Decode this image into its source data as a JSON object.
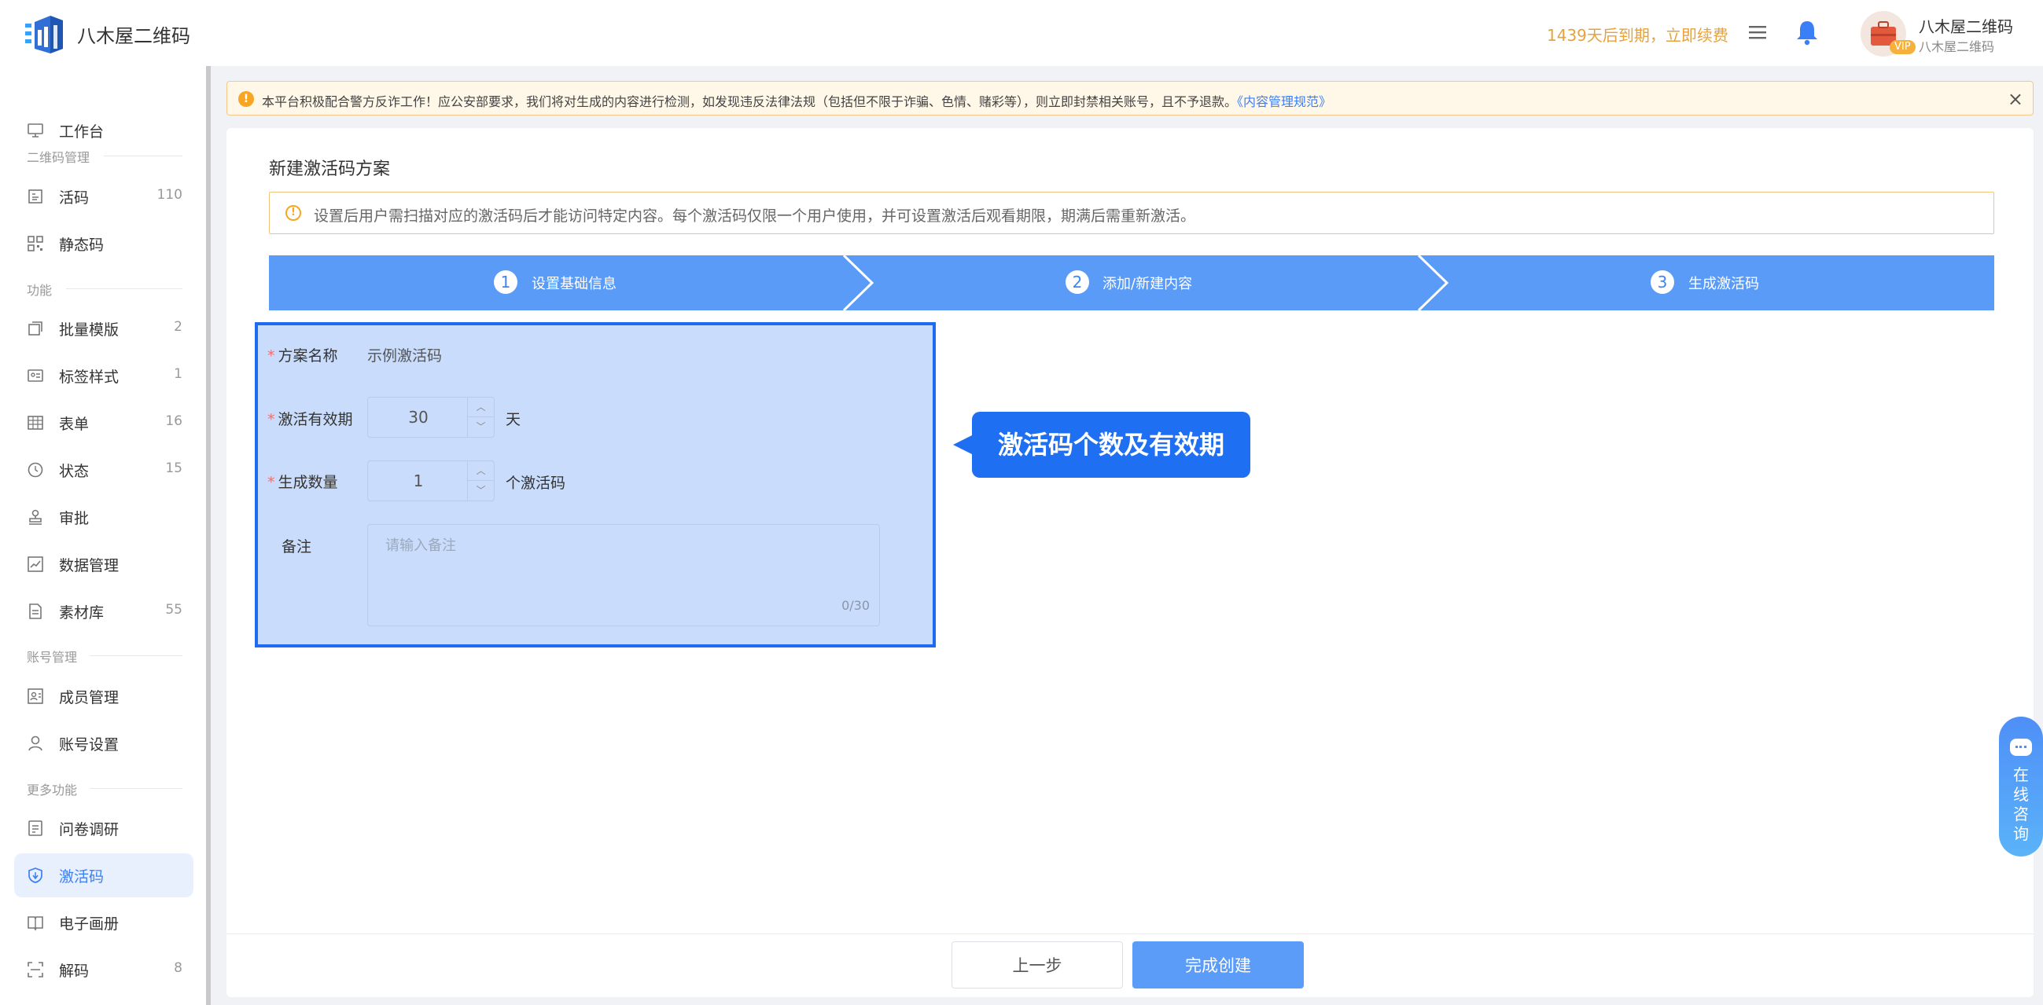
{
  "header": {
    "brand": "八木屋二维码",
    "expire_text": "1439天后到期，立即续费",
    "vip_badge": "VIP",
    "user_name": "八木屋二维码",
    "user_sub": "八木屋二维码"
  },
  "sidebar": {
    "groups": {
      "qrcode": "二维码管理",
      "features": "功能",
      "account": "账号管理",
      "more": "更多功能"
    },
    "items": [
      {
        "label": "工作台",
        "count": ""
      },
      {
        "label": "活码",
        "count": "110"
      },
      {
        "label": "静态码",
        "count": ""
      },
      {
        "label": "批量模版",
        "count": "2"
      },
      {
        "label": "标签样式",
        "count": "1"
      },
      {
        "label": "表单",
        "count": "16"
      },
      {
        "label": "状态",
        "count": "15"
      },
      {
        "label": "审批",
        "count": ""
      },
      {
        "label": "数据管理",
        "count": ""
      },
      {
        "label": "素材库",
        "count": "55"
      },
      {
        "label": "成员管理",
        "count": ""
      },
      {
        "label": "账号设置",
        "count": ""
      },
      {
        "label": "问卷调研",
        "count": ""
      },
      {
        "label": "激活码",
        "count": ""
      },
      {
        "label": "电子画册",
        "count": ""
      },
      {
        "label": "解码",
        "count": "8"
      }
    ]
  },
  "notice": {
    "icon": "!",
    "text": "本平台积极配合警方反诈工作！应公安部要求，我们将对生成的内容进行检测，如发现违反法律法规（包括但不限于诈骗、色情、赌彩等），则立即封禁相关账号，且不予退款。",
    "link": "《内容管理规范》",
    "close": "×"
  },
  "page": {
    "title": "新建激活码方案",
    "tip_icon": "!",
    "tip": "设置后用户需扫描对应的激活码后才能访问特定内容。每个激活码仅限一个用户使用，并可设置激活后观看期限，期满后需重新激活。"
  },
  "steps": [
    {
      "num": "1",
      "label": "设置基础信息"
    },
    {
      "num": "2",
      "label": "添加/新建内容"
    },
    {
      "num": "3",
      "label": "生成激活码"
    }
  ],
  "form": {
    "required_mark": "*",
    "name_label": "方案名称",
    "name_value": "示例激活码",
    "period_label": "激活有效期",
    "period_value": "30",
    "period_unit": "天",
    "qty_label": "生成数量",
    "qty_value": "1",
    "qty_unit": "个激活码",
    "remark_label": "备注",
    "remark_placeholder": "请输入备注",
    "remark_count": "0/30",
    "up_arrow": "︿",
    "down_arrow": "﹀"
  },
  "callout": "激活码个数及有效期",
  "consult": {
    "chars": [
      "在",
      "线",
      "咨",
      "询"
    ]
  },
  "footer": {
    "prev": "上一步",
    "finish": "完成创建"
  },
  "colors": {
    "primary": "#3a7ff6",
    "step_bg": "#5a9bf8",
    "highlight_border": "#1c6bf0",
    "callout_bg": "#1e6ff2",
    "warning": "#f6a623"
  }
}
